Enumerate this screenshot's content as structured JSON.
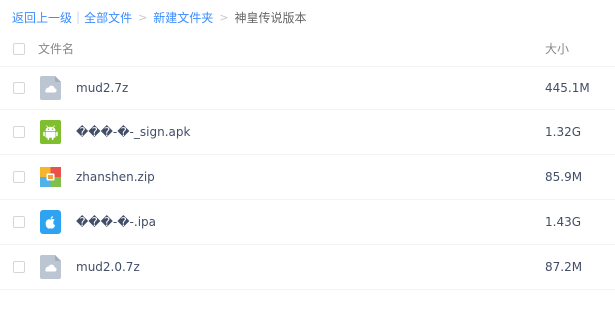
{
  "breadcrumb": {
    "back_label": "返回上一级",
    "separator": "|",
    "items": [
      "全部文件",
      "新建文件夹"
    ],
    "arrow": ">",
    "current": "神皇传说版本"
  },
  "table": {
    "columns": {
      "name": "文件名",
      "size": "大小"
    },
    "rows": [
      {
        "name": "mud2.7z",
        "size": "445.1M",
        "icon": "cloud-archive-icon"
      },
      {
        "name": "���-�-_sign.apk",
        "size": "1.32G",
        "icon": "android-icon"
      },
      {
        "name": "zhanshen.zip",
        "size": "85.9M",
        "icon": "zip-archive-icon"
      },
      {
        "name": "���-�-.ipa",
        "size": "1.43G",
        "icon": "apple-icon"
      },
      {
        "name": "mud2.0.7z",
        "size": "87.2M",
        "icon": "cloud-archive-icon"
      }
    ]
  },
  "colors": {
    "link": "#3b8cff",
    "android": "#7fbe2f",
    "ios": "#2ea3f2",
    "archive": "#bcc6d3"
  }
}
